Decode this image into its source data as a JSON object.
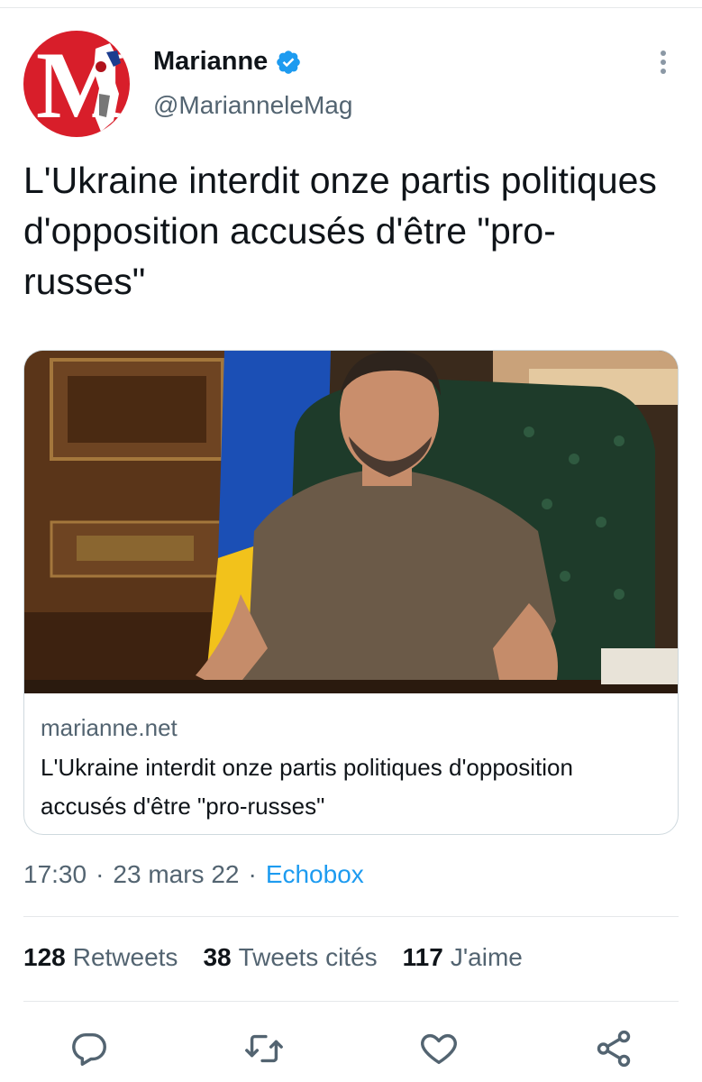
{
  "tweet": {
    "author": {
      "display_name": "Marianne",
      "handle": "@MarianneleMag",
      "avatar_letter": "M",
      "verified": true
    },
    "text": "L'Ukraine interdit onze partis politiques d'opposition accusés d'être \"pro-russes\"",
    "card": {
      "domain": "marianne.net",
      "title": "L'Ukraine interdit onze partis politiques d'opposition accusés d'être \"pro-russes\""
    },
    "meta": {
      "time": "17:30",
      "separator": "·",
      "date": "23 mars 22",
      "source": "Echobox"
    },
    "stats": {
      "retweets_count": "128",
      "retweets_label": "Retweets",
      "quotes_count": "38",
      "quotes_label": "Tweets cités",
      "likes_count": "117",
      "likes_label": "J'aime"
    }
  },
  "colors": {
    "accent": "#1d9bf0",
    "brand_red": "#d81e2a",
    "secondary_text": "#536471",
    "primary_text": "#0f1419",
    "divider": "#e6e8ea"
  },
  "icons": {
    "reply": "reply-icon",
    "retweet": "retweet-icon",
    "like": "like-icon",
    "share": "share-icon",
    "more": "more-vertical-icon",
    "verified": "verified-badge-icon"
  }
}
